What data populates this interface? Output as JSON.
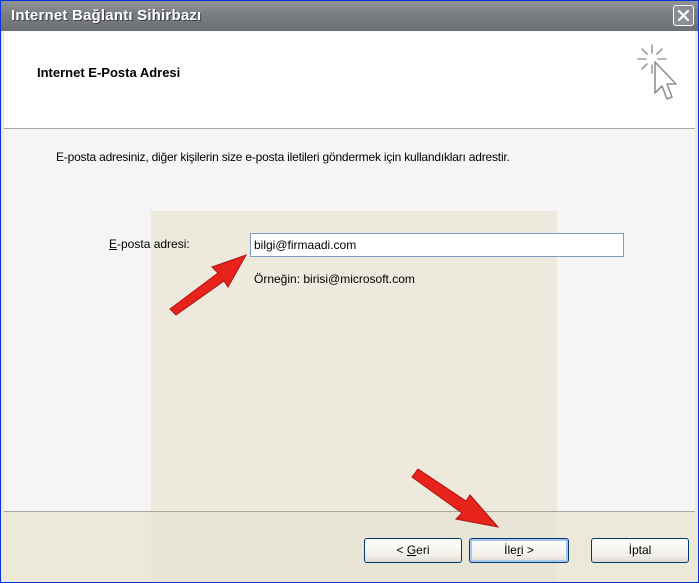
{
  "window": {
    "title": "Internet Bağlantı Sihirbazı"
  },
  "header": {
    "title": "Internet E-Posta Adresi",
    "icon": "wizard-cursor-icon"
  },
  "main": {
    "description": "E-posta adresiniz, diğer kişilerin size e-posta iletileri göndermek için kullandıkları adrestir.",
    "email_label_accel": "E",
    "email_label_rest": "-posta adresi:",
    "email_value": "bilgi@firmaadi.com",
    "example_text": "Örneğin: birisi@microsoft.com"
  },
  "buttons": {
    "back_prefix": "< ",
    "back_accel": "G",
    "back_rest": "eri",
    "next_prefix": "İle",
    "next_accel": "r",
    "next_rest": "i >",
    "cancel_label": "İptal"
  },
  "colors": {
    "annotation_arrow": "#e8231b"
  }
}
